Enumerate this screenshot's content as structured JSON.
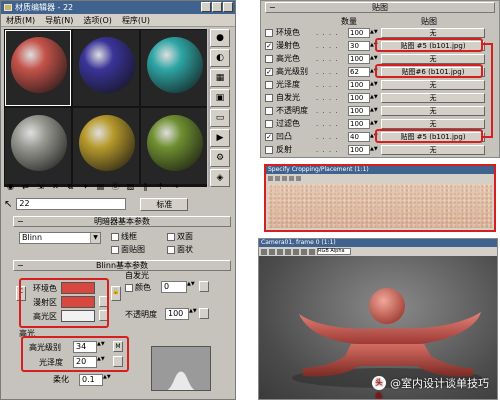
{
  "editor": {
    "title": "材质编辑器 - 22",
    "menu": [
      "材质(M)",
      "导航(N)",
      "选项(O)",
      "程序(U)"
    ],
    "material_slots": [
      {
        "name": "slot-1",
        "color": "#c4534a"
      },
      {
        "name": "slot-2",
        "color": "#3a3499"
      },
      {
        "name": "slot-3",
        "color": "#2fa5a5"
      },
      {
        "name": "slot-4",
        "color": "#9a9a94"
      },
      {
        "name": "slot-5",
        "color": "#b79a2c"
      },
      {
        "name": "slot-6",
        "color": "#6f8f30"
      }
    ],
    "material_name": "22",
    "material_type": "标准",
    "shader_rollout": {
      "title": "明暗器基本参数",
      "shader": "Blinn",
      "options": [
        "线框",
        "双面",
        "面贴图",
        "面状"
      ]
    },
    "blinn_rollout": {
      "title": "Blinn基本参数",
      "self_illum_label": "自发光",
      "color_label": "颜色",
      "self_illum_value": "0",
      "ambient_label": "环境色",
      "diffuse_label": "漫射区",
      "specular_label": "高光区",
      "opacity_label": "不透明度",
      "opacity_value": "100",
      "ambient_color": "#d9483f",
      "diffuse_color": "#d9483f",
      "specular_color": "#f2f2f2"
    },
    "highlight": {
      "title": "高光",
      "level_label": "高光级别",
      "level_value": "34",
      "gloss_label": "光泽度",
      "gloss_value": "20",
      "soften_label": "柔化",
      "soften_value": "0.1"
    }
  },
  "maps": {
    "title": "贴图",
    "col_amount": "数量",
    "col_map": "贴图",
    "rows": [
      {
        "name": "环境色",
        "checked": false,
        "amount": "100",
        "map": "无"
      },
      {
        "name": "漫射色",
        "checked": true,
        "amount": "30",
        "map": "贴图 #5 (b101.jpg)"
      },
      {
        "name": "高光色",
        "checked": false,
        "amount": "100",
        "map": "无"
      },
      {
        "name": "高光级别",
        "checked": true,
        "amount": "62",
        "map": "贴图#6 (b101.jpg)"
      },
      {
        "name": "光泽度",
        "checked": false,
        "amount": "100",
        "map": "无"
      },
      {
        "name": "自发光",
        "checked": false,
        "amount": "100",
        "map": "无"
      },
      {
        "name": "不透明度",
        "checked": false,
        "amount": "100",
        "map": "无"
      },
      {
        "name": "过滤色",
        "checked": false,
        "amount": "100",
        "map": "无"
      },
      {
        "name": "凹凸",
        "checked": true,
        "amount": "40",
        "map": "贴图 #5 (b101.jpg)"
      },
      {
        "name": "反射",
        "checked": false,
        "amount": "100",
        "map": "无"
      }
    ]
  },
  "texture_window": {
    "title": "Specify Cropping/Placement (1:1)"
  },
  "render_window": {
    "title": "Camera01, frame 0 (1:1)",
    "channel": "RGB Alpha"
  },
  "watermark": {
    "prefix": "头条",
    "text": "@室内设计谈单技巧"
  }
}
